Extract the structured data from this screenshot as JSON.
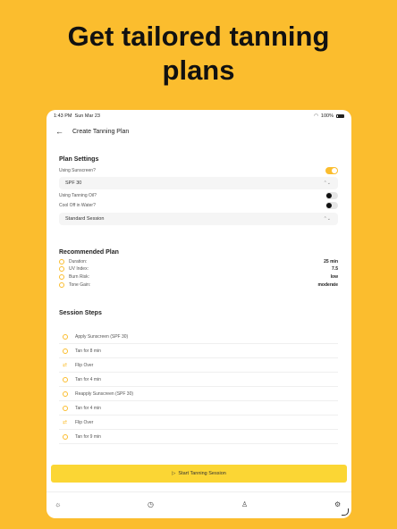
{
  "headline": {
    "line1": "Get tailored tanning",
    "line2": "plans"
  },
  "status_bar": {
    "time": "1:43 PM",
    "date": "Sun Mar 23",
    "battery": "100%"
  },
  "nav": {
    "title": "Create Tanning Plan"
  },
  "plan_settings": {
    "title": "Plan Settings",
    "using_sunscreen_label": "Using Sunscreen?",
    "using_sunscreen": true,
    "spf_value": "SPF 30",
    "using_tanning_oil_label": "Using Tanning Oil?",
    "using_tanning_oil": false,
    "cool_off_label": "Cool Off in Water?",
    "cool_off": false,
    "session_value": "Standard Session"
  },
  "recommended_plan": {
    "title": "Recommended Plan",
    "rows": [
      {
        "label": "Duration:",
        "value": "25 min"
      },
      {
        "label": "UV Index:",
        "value": "7.5"
      },
      {
        "label": "Burn Risk:",
        "value": "low"
      },
      {
        "label": "Tone Gain:",
        "value": "moderate"
      }
    ]
  },
  "session_steps": {
    "title": "Session Steps",
    "steps": [
      {
        "label": "Apply Sunscreen (SPF 30)",
        "icon": "clock-icon"
      },
      {
        "label": "Tan for 8 min",
        "icon": "clock-icon"
      },
      {
        "label": "Flip Over",
        "icon": "flip-icon"
      },
      {
        "label": "Tan for 4 min",
        "icon": "clock-icon"
      },
      {
        "label": "Reapply Sunscreen (SPF 30)",
        "icon": "clock-icon"
      },
      {
        "label": "Tan for 4 min",
        "icon": "clock-icon"
      },
      {
        "label": "Flip Over",
        "icon": "flip-icon"
      },
      {
        "label": "Tan for 9 min",
        "icon": "clock-icon"
      }
    ]
  },
  "cta": {
    "label": "Start Tanning Session",
    "icon": "play-icon"
  },
  "tabs": [
    {
      "icon": "sun-icon"
    },
    {
      "icon": "timer-icon"
    },
    {
      "icon": "person-icon"
    },
    {
      "icon": "gear-icon"
    }
  ],
  "colors": {
    "accent": "#FBBD2E",
    "cta": "#FBD634"
  }
}
